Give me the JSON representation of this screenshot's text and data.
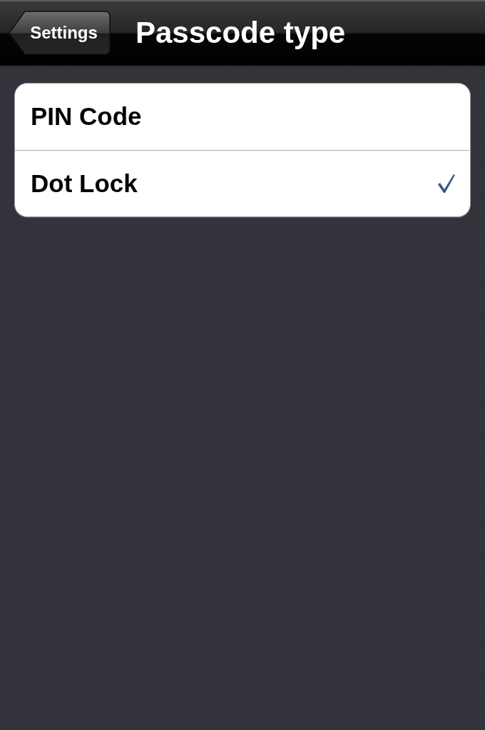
{
  "navigation_bar": {
    "back_button": "Settings",
    "title": "Passcode type"
  },
  "options": [
    {
      "label": "PIN Code",
      "selected": false
    },
    {
      "label": "Dot Lock",
      "selected": true
    }
  ]
}
